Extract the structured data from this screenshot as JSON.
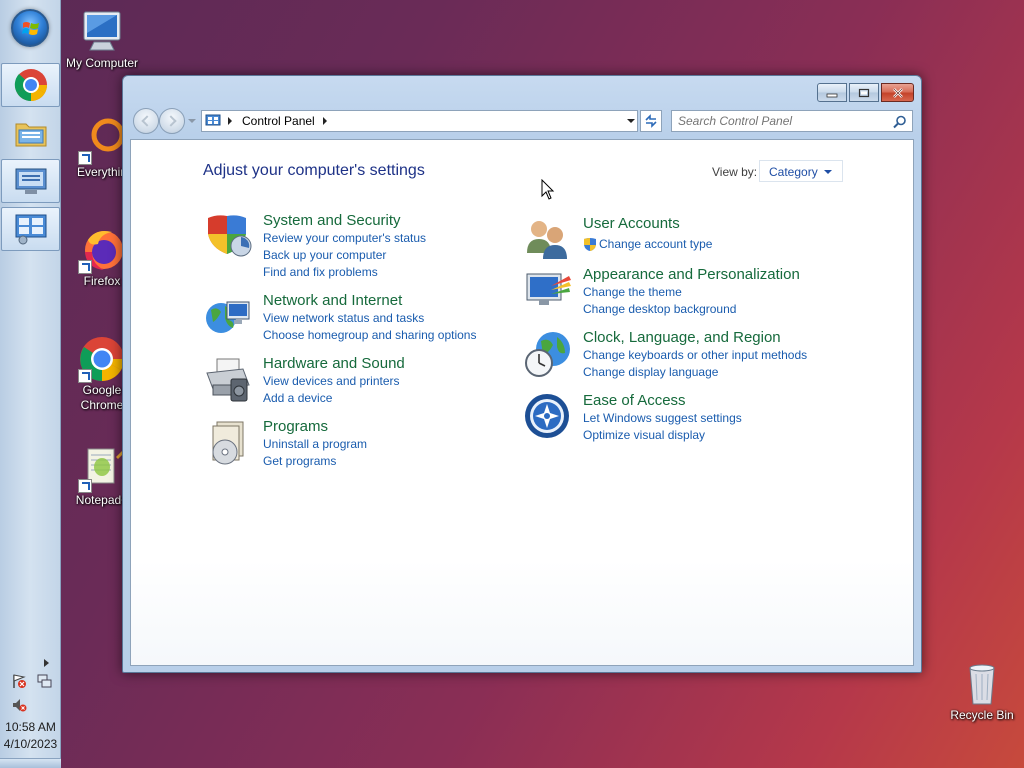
{
  "desktop": {
    "icons": [
      {
        "label": "My Computer",
        "icon": "computer-icon"
      },
      {
        "label": "Everythin",
        "icon": "everything-search-icon"
      },
      {
        "label": "Firefox",
        "icon": "firefox-icon"
      },
      {
        "label": "Google Chrome",
        "icon": "chrome-icon"
      },
      {
        "label": "Notepad+",
        "icon": "notepad-plus-plus-icon"
      },
      {
        "label": "Recycle Bin",
        "icon": "recycle-bin-icon"
      }
    ]
  },
  "taskbar": {
    "items": [
      "start-orb",
      "chrome-icon",
      "file-explorer-icon",
      "remote-desktop-icon",
      "control-panel-icon"
    ],
    "tray": {
      "time": "10:58 AM",
      "date": "4/10/2023"
    }
  },
  "window": {
    "address": {
      "crumb": "Control Panel"
    },
    "search": {
      "placeholder": "Search Control Panel"
    },
    "heading": "Adjust your computer's settings",
    "view_by": {
      "label": "View by:",
      "value": "Category"
    },
    "categories": [
      {
        "title": "System and Security",
        "icon": "shield-icon",
        "links": [
          "Review your computer's status",
          "Back up your computer",
          "Find and fix problems"
        ]
      },
      {
        "title": "Network and Internet",
        "icon": "network-globe-icon",
        "links": [
          "View network status and tasks",
          "Choose homegroup and sharing options"
        ]
      },
      {
        "title": "Hardware and Sound",
        "icon": "printer-icon",
        "links": [
          "View devices and printers",
          "Add a device"
        ]
      },
      {
        "title": "Programs",
        "icon": "programs-disc-icon",
        "links": [
          "Uninstall a program",
          "Get programs"
        ]
      },
      {
        "title": "User Accounts",
        "icon": "users-icon",
        "links": [
          "Change account type"
        ]
      },
      {
        "title": "Appearance and Personalization",
        "icon": "display-paint-icon",
        "links": [
          "Change the theme",
          "Change desktop background"
        ]
      },
      {
        "title": "Clock, Language, and Region",
        "icon": "clock-globe-icon",
        "links": [
          "Change keyboards or other input methods",
          "Change display language"
        ]
      },
      {
        "title": "Ease of Access",
        "icon": "ease-of-access-icon",
        "links": [
          "Let Windows suggest settings",
          "Optimize visual display"
        ]
      }
    ]
  }
}
